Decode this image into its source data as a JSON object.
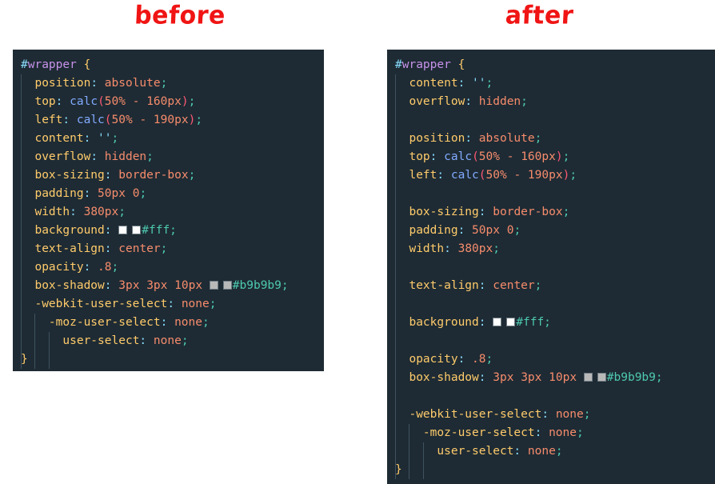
{
  "page": {
    "background_color": "#ffffff",
    "title_color": "#f01414",
    "code_background_color": "#1e2b34",
    "indent_guide_color": "#3f5260"
  },
  "columns": [
    {
      "id": "before",
      "title": "before"
    },
    {
      "id": "after",
      "title": "after"
    }
  ],
  "palette": {
    "selector_hash": "#89ddff",
    "selector_name": "#c792ea",
    "brace": "#ffcb6b",
    "property": "#ffcb6b",
    "colon": "#89ddff",
    "value": "#f78c6c",
    "function": "#82aaff",
    "paren": "#ff5874",
    "string": "#89ddff",
    "hex_value": "#4ec9b0",
    "semicolon": "#4ec9b0"
  },
  "swatches": {
    "white": "#ffffff",
    "grey": "#b9b9b9"
  },
  "code_before": {
    "selector": "#wrapper",
    "open_brace": "{",
    "close_brace": "}",
    "line_count": 14,
    "declarations": [
      {
        "property": "position",
        "value": "absolute",
        "indent": 1
      },
      {
        "property": "top",
        "value": "calc(50% - 160px)",
        "indent": 1
      },
      {
        "property": "left",
        "value": "calc(50% - 190px)",
        "indent": 1
      },
      {
        "property": "content",
        "value": "''",
        "indent": 1
      },
      {
        "property": "overflow",
        "value": "hidden",
        "indent": 1
      },
      {
        "property": "box-sizing",
        "value": "border-box",
        "indent": 1
      },
      {
        "property": "padding",
        "value": "50px 0",
        "indent": 1
      },
      {
        "property": "width",
        "value": "380px",
        "indent": 1
      },
      {
        "property": "background",
        "value": "#fff",
        "indent": 1,
        "swatch": "white"
      },
      {
        "property": "text-align",
        "value": "center",
        "indent": 1
      },
      {
        "property": "opacity",
        "value": ".8",
        "indent": 1
      },
      {
        "property": "box-shadow",
        "value": "3px 3px 10px #b9b9b9",
        "indent": 1,
        "swatch": "grey"
      },
      {
        "property": "-webkit-user-select",
        "value": "none",
        "indent": 1
      },
      {
        "property": "-moz-user-select",
        "value": "none",
        "indent": 2
      },
      {
        "property": "user-select",
        "value": "none",
        "indent": 3
      }
    ]
  },
  "code_after": {
    "selector": "#wrapper",
    "open_brace": "{",
    "close_brace": "}",
    "line_count": 22,
    "groups": [
      [
        {
          "property": "content",
          "value": "''",
          "indent": 1
        },
        {
          "property": "overflow",
          "value": "hidden",
          "indent": 1
        }
      ],
      [
        {
          "property": "position",
          "value": "absolute",
          "indent": 1
        },
        {
          "property": "top",
          "value": "calc(50% - 160px)",
          "indent": 1
        },
        {
          "property": "left",
          "value": "calc(50% - 190px)",
          "indent": 1
        }
      ],
      [
        {
          "property": "box-sizing",
          "value": "border-box",
          "indent": 1
        },
        {
          "property": "padding",
          "value": "50px 0",
          "indent": 1
        },
        {
          "property": "width",
          "value": "380px",
          "indent": 1
        }
      ],
      [
        {
          "property": "text-align",
          "value": "center",
          "indent": 1
        }
      ],
      [
        {
          "property": "background",
          "value": "#fff",
          "indent": 1,
          "swatch": "white"
        }
      ],
      [
        {
          "property": "opacity",
          "value": ".8",
          "indent": 1
        },
        {
          "property": "box-shadow",
          "value": "3px 3px 10px #b9b9b9",
          "indent": 1,
          "swatch": "grey"
        }
      ],
      [
        {
          "property": "-webkit-user-select",
          "value": "none",
          "indent": 1
        },
        {
          "property": "-moz-user-select",
          "value": "none",
          "indent": 2
        },
        {
          "property": "user-select",
          "value": "none",
          "indent": 3
        }
      ]
    ]
  }
}
